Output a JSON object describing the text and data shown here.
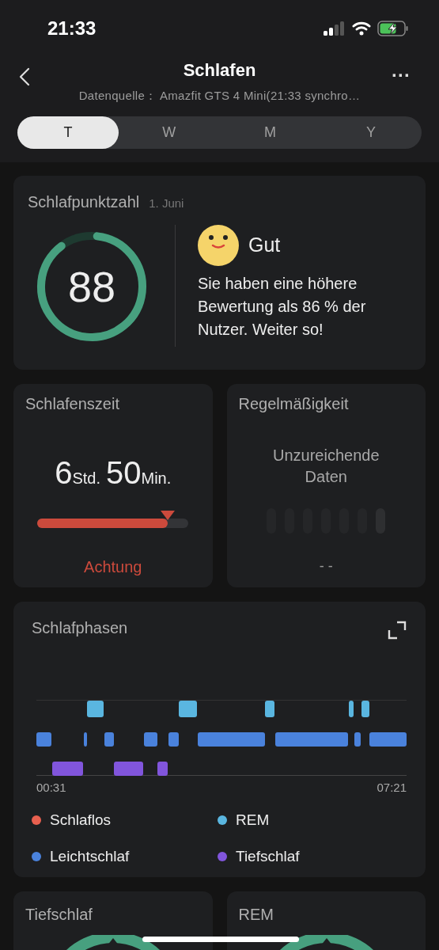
{
  "status_bar": {
    "time": "21:33"
  },
  "header": {
    "title": "Schlafen",
    "subtitle": "Datenquelle：  Amazfit GTS 4 Mini(21:33 synchro…",
    "more": "···"
  },
  "tabs": [
    {
      "label": "T",
      "selected": true
    },
    {
      "label": "W",
      "selected": false
    },
    {
      "label": "M",
      "selected": false
    },
    {
      "label": "Y",
      "selected": false
    }
  ],
  "score_card": {
    "title": "Schlafpunktzahl",
    "date": "1. Juni",
    "score": "88",
    "rating": "Gut",
    "message": "Sie haben eine höhere Bewertung als 86 % der Nutzer. Weiter so!"
  },
  "sleep_time_card": {
    "title": "Schlafenszeit",
    "hours": "6",
    "hours_unit": "Std.",
    "minutes": "50",
    "minutes_unit": "Min.",
    "level": 0.86,
    "status": "Achtung"
  },
  "regularity_card": {
    "title": "Regelmäßigkeit",
    "message": "Unzureichende Daten",
    "value": "- -"
  },
  "phases_card": {
    "title": "Schlafphasen",
    "start_time": "00:31",
    "end_time": "07:21",
    "legend": [
      {
        "label": "Schlaflos",
        "color": "#e8604f"
      },
      {
        "label": "REM",
        "color": "#5ab6e0"
      },
      {
        "label": "Leichtschlaf",
        "color": "#4a82dc"
      },
      {
        "label": "Tiefschlaf",
        "color": "#8155dc"
      }
    ]
  },
  "bottom_cards": [
    {
      "title": "Tiefschlaf"
    },
    {
      "title": "REM"
    }
  ]
}
